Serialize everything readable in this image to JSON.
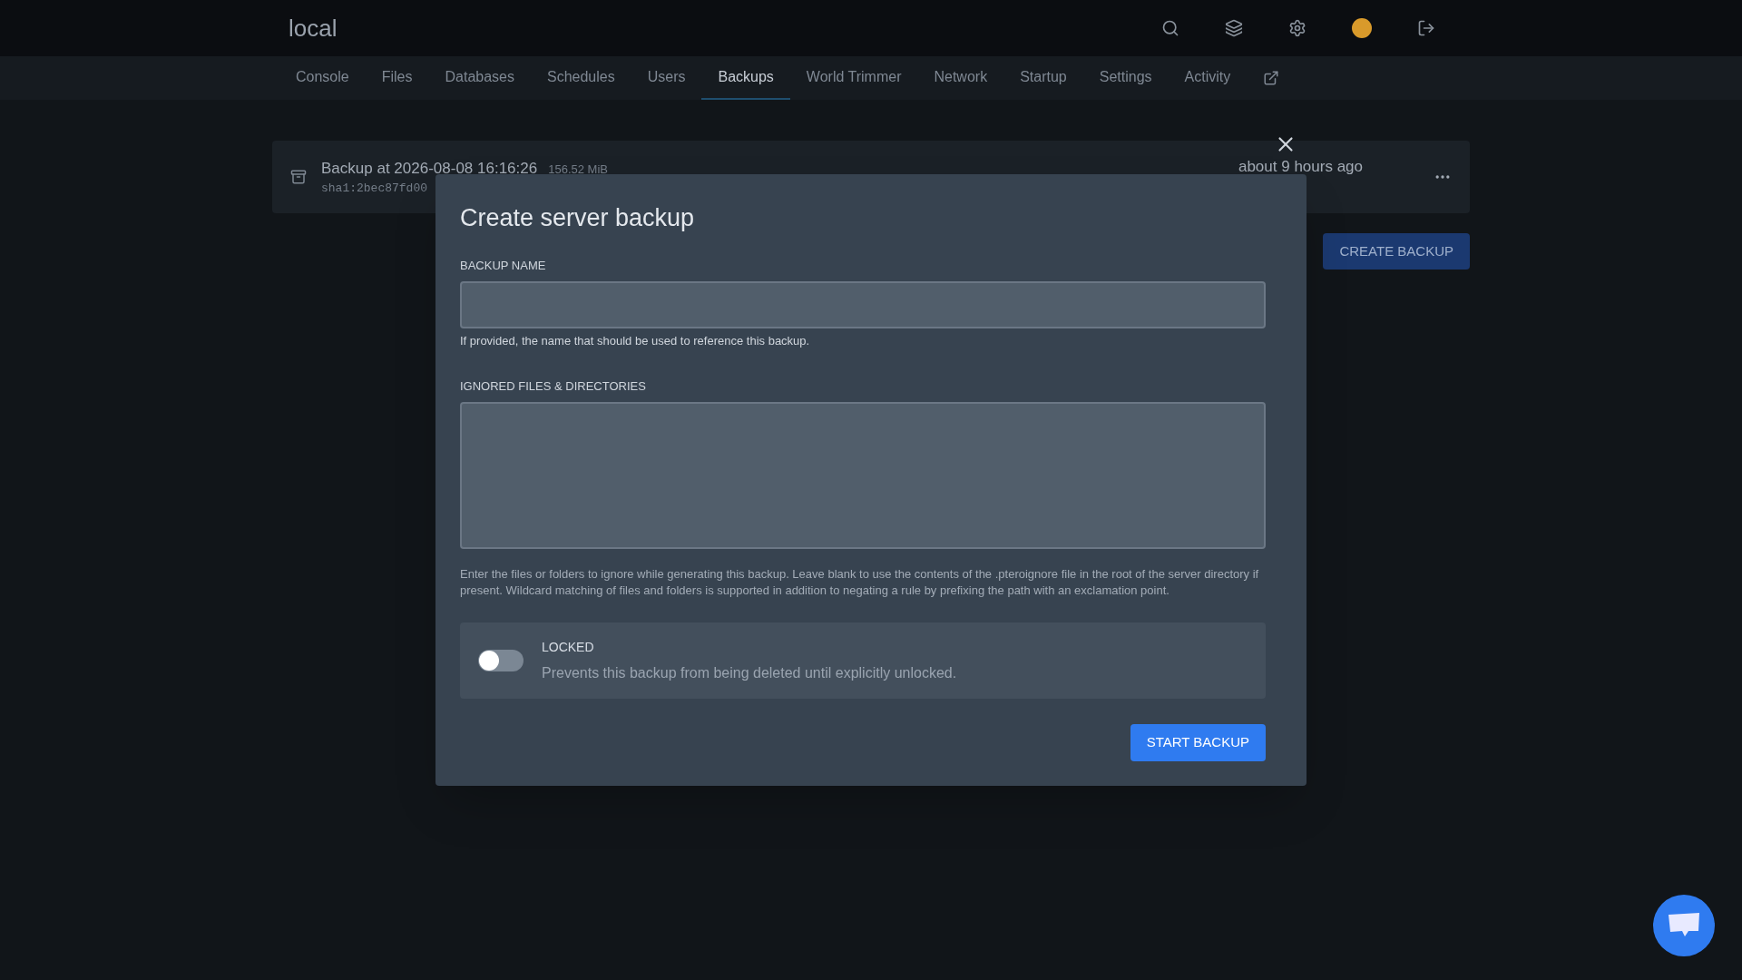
{
  "header": {
    "title": "local"
  },
  "nav": [
    {
      "label": "Console",
      "selected": false
    },
    {
      "label": "Files",
      "selected": false
    },
    {
      "label": "Databases",
      "selected": false
    },
    {
      "label": "Schedules",
      "selected": false
    },
    {
      "label": "Users",
      "selected": false
    },
    {
      "label": "Backups",
      "selected": true
    },
    {
      "label": "World Trimmer",
      "selected": false
    },
    {
      "label": "Network",
      "selected": false
    },
    {
      "label": "Startup",
      "selected": false
    },
    {
      "label": "Settings",
      "selected": false
    },
    {
      "label": "Activity",
      "selected": false
    }
  ],
  "backup": {
    "name": "Backup at 2026-08-08 16:16:26",
    "size": "156.52 MiB",
    "checksum": "sha1:2bec87fd00",
    "time": "about 9 hours ago"
  },
  "create_button": "CREATE BACKUP",
  "modal": {
    "title": "Create server backup",
    "name_label": "BACKUP NAME",
    "name_help": "If provided, the name that should be used to reference this backup.",
    "ignored_label": "IGNORED FILES & DIRECTORIES",
    "ignored_help": "Enter the files or folders to ignore while generating this backup. Leave blank to use the contents of the .pteroignore file in the root of the server directory if present. Wildcard matching of files and folders is supported in addition to negating a rule by prefixing the path with an exclamation point.",
    "locked": {
      "label": "LOCKED",
      "description": "Prevents this backup from being deleted until explicitly unlocked.",
      "on": false
    },
    "submit": "START BACKUP"
  }
}
